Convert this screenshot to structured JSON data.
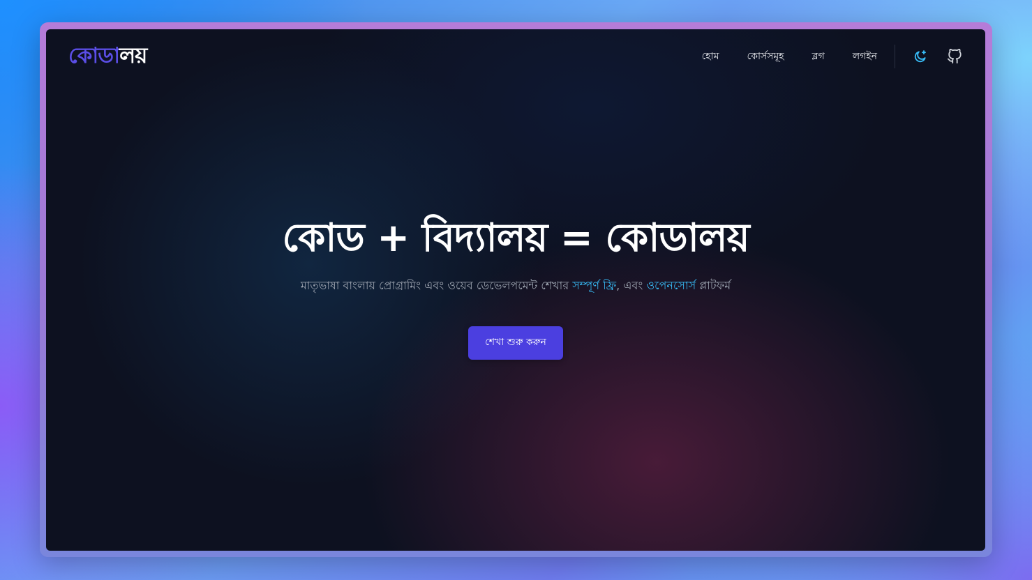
{
  "brand": {
    "logo_part1": "কোড",
    "logo_part2": "ালয়"
  },
  "nav": {
    "links": [
      {
        "label": "হোম"
      },
      {
        "label": "কোর্সসমূহ"
      },
      {
        "label": "ব্লগ"
      },
      {
        "label": "লগইন"
      }
    ],
    "theme_icon": "moon-star-icon",
    "repo_icon": "github-icon"
  },
  "hero": {
    "title": "কোড + বিদ্যালয় = কোডালয়",
    "subtitle_part1": "মাতৃভাষা বাংলায় প্রোগ্রামিং এবং ওয়েব ডেভেলপমেন্ট শেখার ",
    "subtitle_highlight1": "সম্পূর্ণ ফ্রি",
    "subtitle_part2": ", এবং ",
    "subtitle_highlight2": "ওপেনসোর্স",
    "subtitle_part3": " প্লাটফর্ম",
    "cta_label": "শেখা শুরু করুন"
  },
  "colors": {
    "brand_purple": "#5b4ee6",
    "accent_cyan": "#38bdf8",
    "button_bg": "#4b3fe0",
    "page_bg": "#0d1120"
  }
}
